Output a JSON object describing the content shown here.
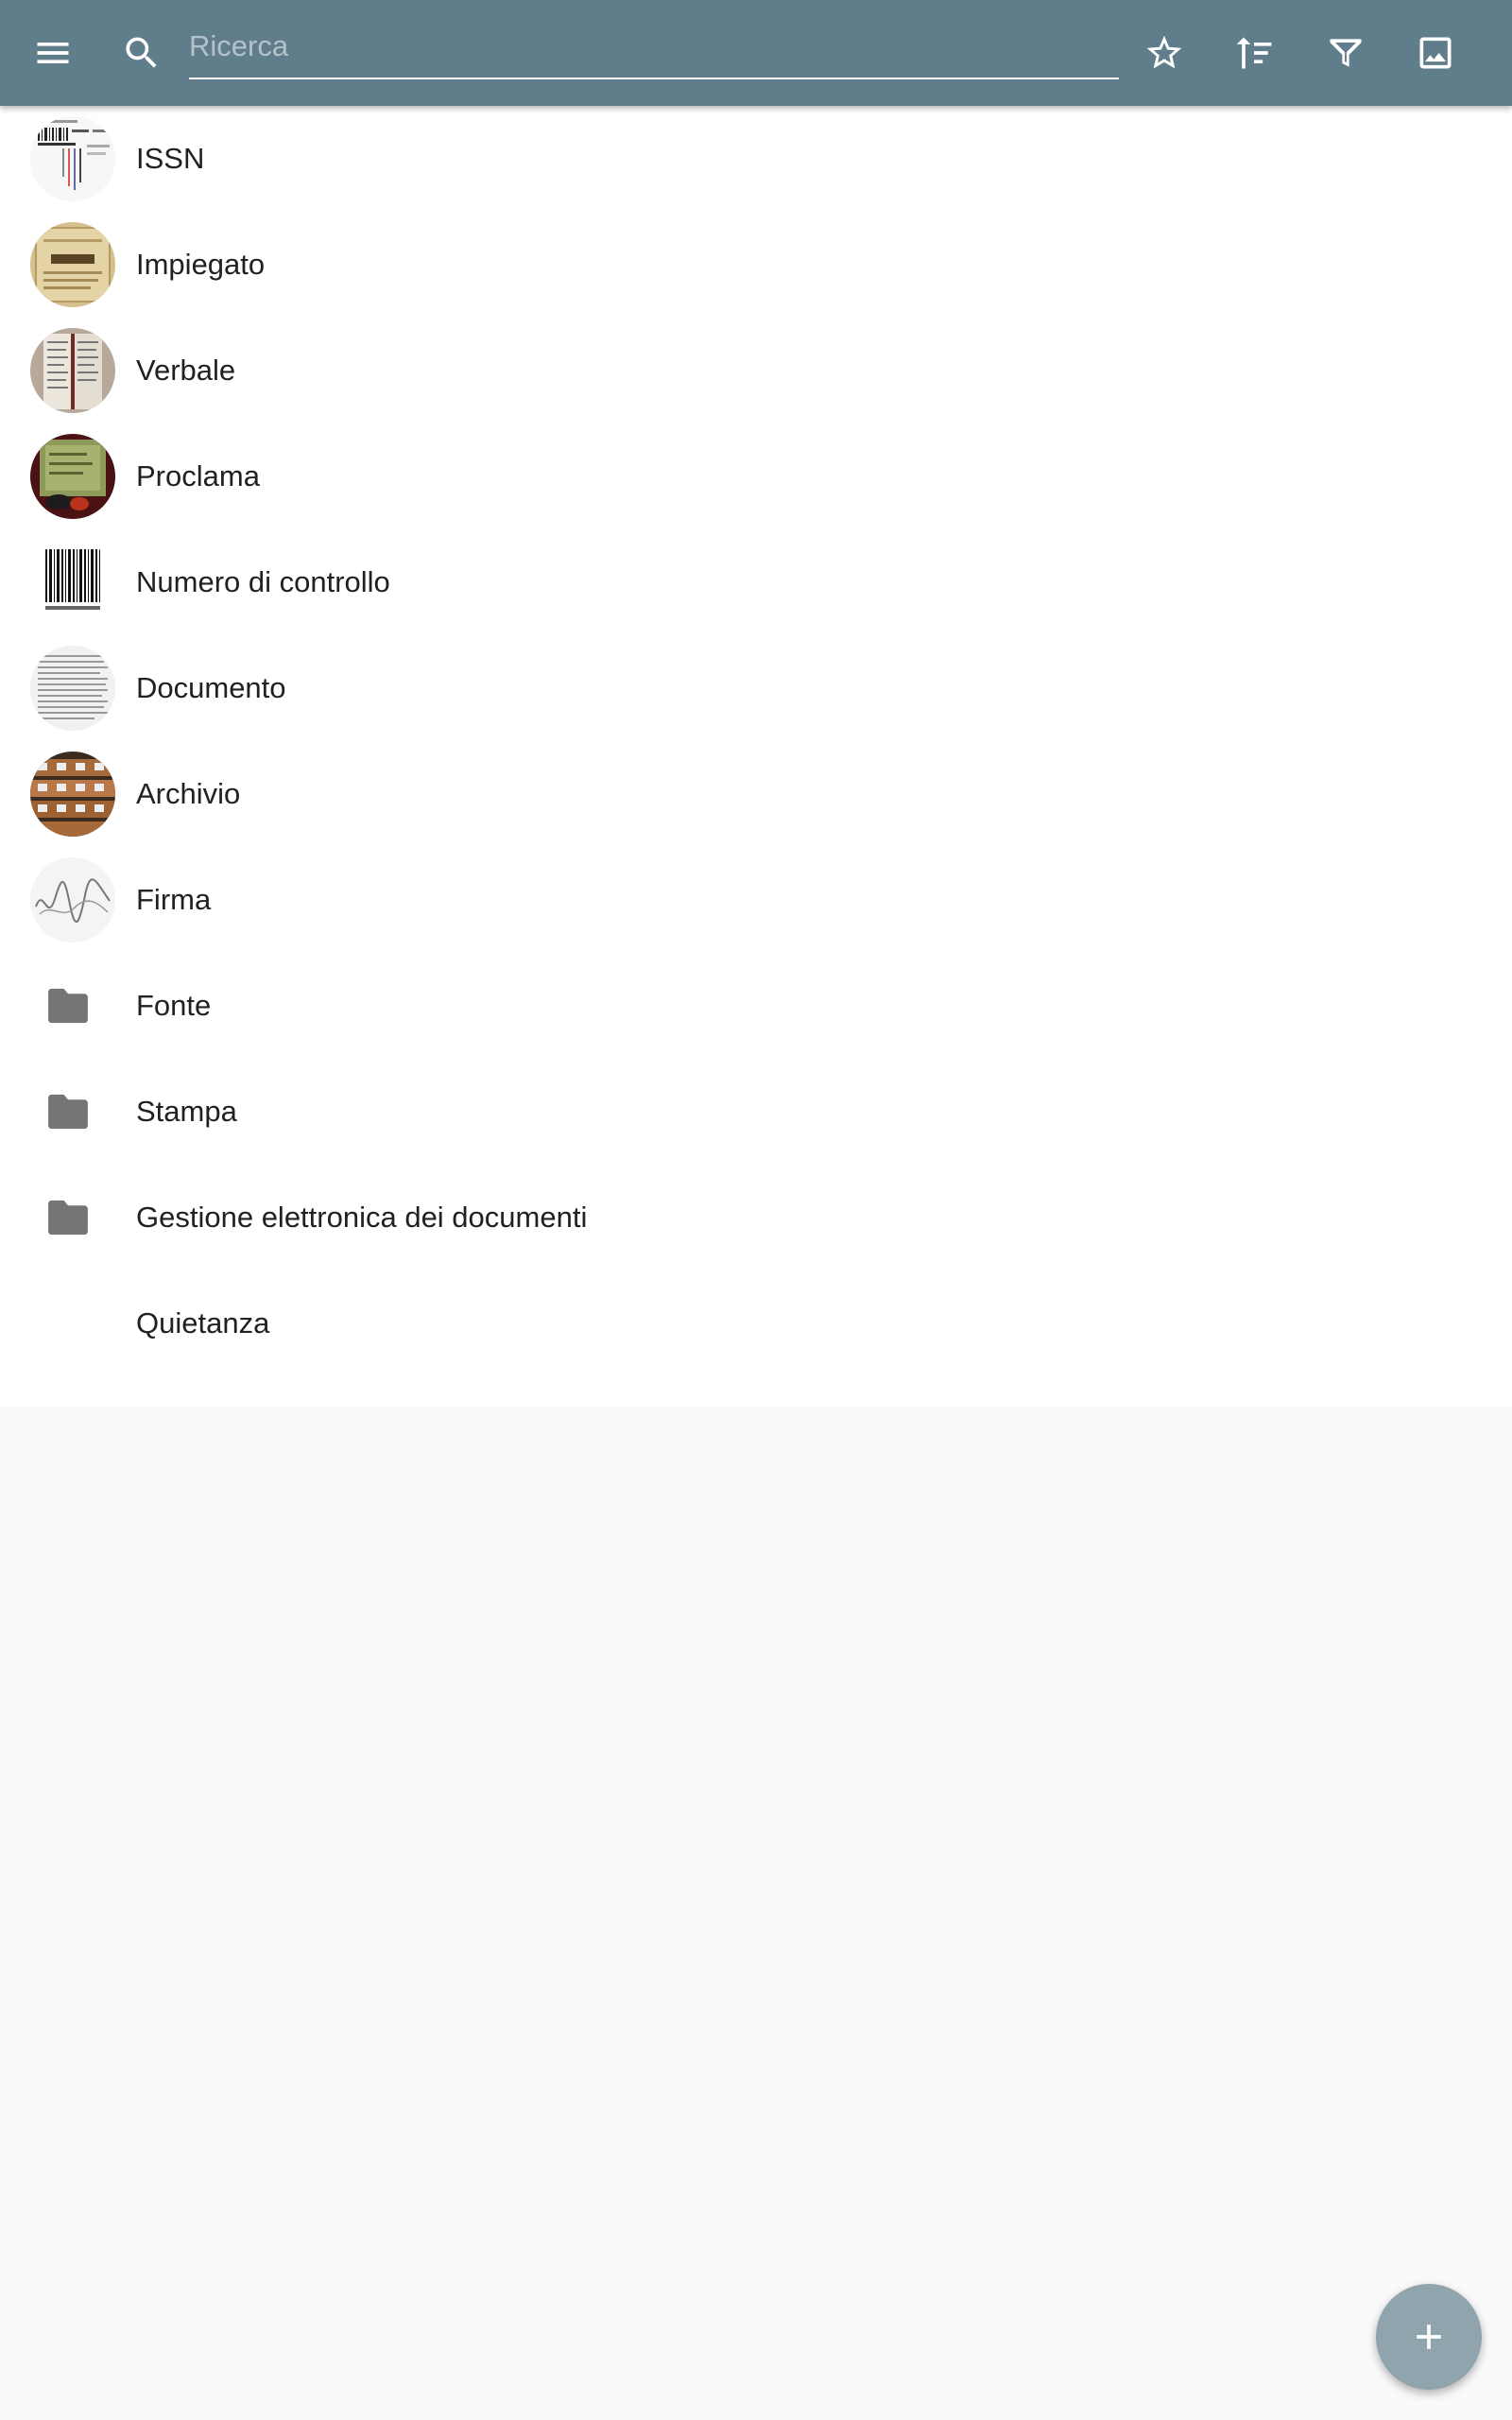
{
  "toolbar": {
    "search_placeholder": "Ricerca",
    "accent_color": "#607d8b",
    "icons": [
      "menu-icon",
      "search-icon",
      "star-outline-icon",
      "sort-icon",
      "filter-icon",
      "image-icon"
    ]
  },
  "items": [
    {
      "label": "ISSN",
      "thumb": "issn-barcode-image"
    },
    {
      "label": "Impiegato",
      "thumb": "old-document-image"
    },
    {
      "label": "Verbale",
      "thumb": "book-pages-image"
    },
    {
      "label": "Proclama",
      "thumb": "proclamation-image"
    },
    {
      "label": "Numero di controllo",
      "thumb": "barcode-image"
    },
    {
      "label": "Documento",
      "thumb": "text-document-image"
    },
    {
      "label": "Archivio",
      "thumb": "archive-shelves-image"
    },
    {
      "label": "Firma",
      "thumb": "signature-image"
    },
    {
      "label": "Fonte",
      "thumb": "folder-icon"
    },
    {
      "label": "Stampa",
      "thumb": "folder-icon"
    },
    {
      "label": "Gestione elettronica dei documenti",
      "thumb": "folder-icon"
    },
    {
      "label": "Quietanza",
      "thumb": ""
    }
  ],
  "fab": {
    "icon": "plus-icon",
    "color": "#90a4ae"
  }
}
